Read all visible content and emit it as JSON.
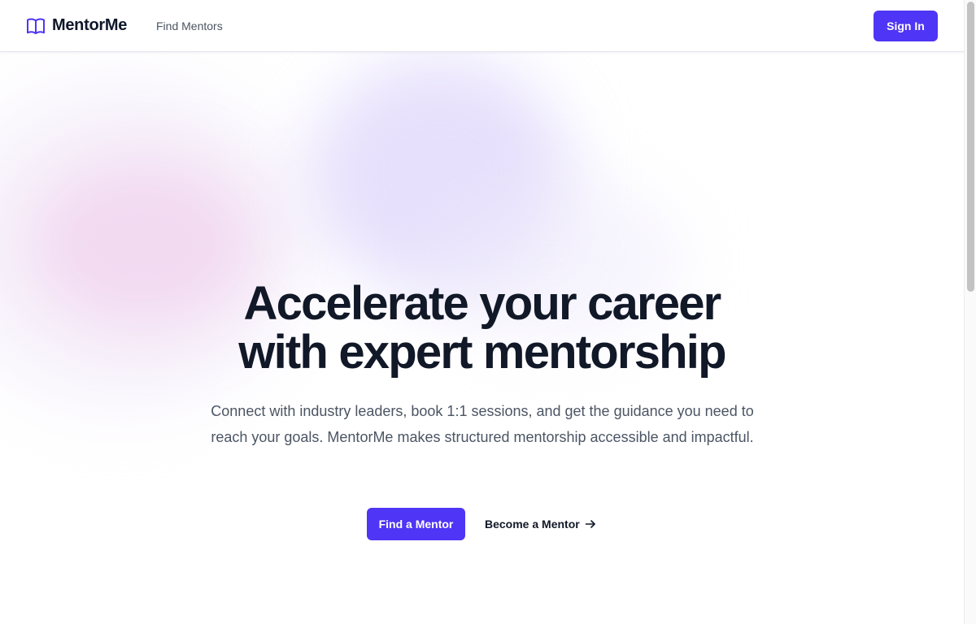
{
  "brand": {
    "name": "MentorMe",
    "icon": "book-open-icon",
    "accent_color": "#4f35f5"
  },
  "nav": {
    "find_mentors": "Find Mentors"
  },
  "header": {
    "sign_in_label": "Sign In"
  },
  "hero": {
    "title_line1": "Accelerate your career",
    "title_line2": "with expert mentorship",
    "subtitle": "Connect with industry leaders, book 1:1 sessions, and get the guidance you need to reach your goals. MentorMe makes structured mentorship accessible and impactful.",
    "primary_cta": "Find a Mentor",
    "secondary_cta": "Become a Mentor",
    "secondary_icon": "arrow-right-icon"
  },
  "colors": {
    "primary": "#4f35f5",
    "heading": "#111827",
    "body_text": "#4b5563"
  }
}
